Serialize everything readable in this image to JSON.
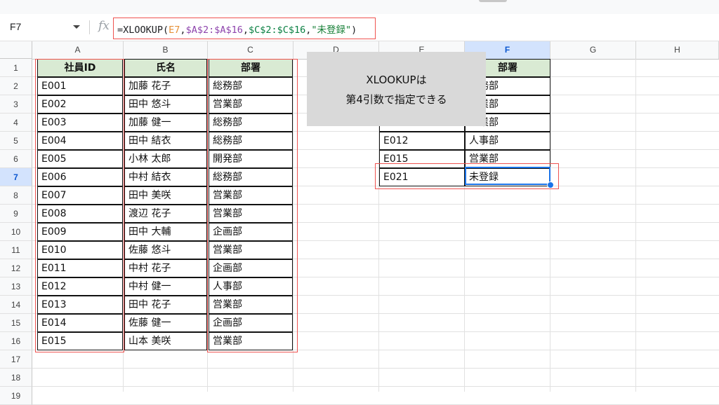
{
  "name_box": "F7",
  "fx_label": "fx",
  "formula": {
    "p1": "=XLOOKUP(",
    "p2": "E7",
    "p3": ",",
    "p4": "$A$2:$A$16",
    "p5": ",",
    "p6": "$C$2:$C$16",
    "p7": ",",
    "p8": "\"未登録\"",
    "p9": ")"
  },
  "columns": [
    "A",
    "B",
    "C",
    "D",
    "E",
    "F",
    "G",
    "H"
  ],
  "rows": [
    "1",
    "2",
    "3",
    "4",
    "5",
    "6",
    "7",
    "8",
    "9",
    "10",
    "11",
    "12",
    "13",
    "14",
    "15",
    "16",
    "17",
    "18",
    "19"
  ],
  "selected_column": "F",
  "selected_row": "7",
  "master_table": {
    "headers": [
      "社員ID",
      "氏名",
      "部署"
    ],
    "rows": [
      [
        "E001",
        "加藤 花子",
        "総務部"
      ],
      [
        "E002",
        "田中 悠斗",
        "営業部"
      ],
      [
        "E003",
        "加藤 健一",
        "総務部"
      ],
      [
        "E004",
        "田中 結衣",
        "総務部"
      ],
      [
        "E005",
        "小林 太郎",
        "開発部"
      ],
      [
        "E006",
        "中村 結衣",
        "総務部"
      ],
      [
        "E007",
        "田中 美咲",
        "営業部"
      ],
      [
        "E008",
        "渡辺 花子",
        "営業部"
      ],
      [
        "E009",
        "田中 大輔",
        "企画部"
      ],
      [
        "E010",
        "佐藤 悠斗",
        "営業部"
      ],
      [
        "E011",
        "中村 花子",
        "企画部"
      ],
      [
        "E012",
        "中村 健一",
        "人事部"
      ],
      [
        "E013",
        "田中 花子",
        "営業部"
      ],
      [
        "E014",
        "佐藤 健一",
        "企画部"
      ],
      [
        "E015",
        "山本 美咲",
        "営業部"
      ]
    ]
  },
  "lookup_table": {
    "header_f": "部署",
    "partial": [
      "務部",
      "業部",
      "業部"
    ],
    "rows": [
      [
        "E012",
        "人事部"
      ],
      [
        "E015",
        "営業部"
      ],
      [
        "E021",
        "未登録"
      ]
    ]
  },
  "callout": {
    "line1": "XLOOKUPは",
    "line2": "第4引数で指定できる"
  }
}
